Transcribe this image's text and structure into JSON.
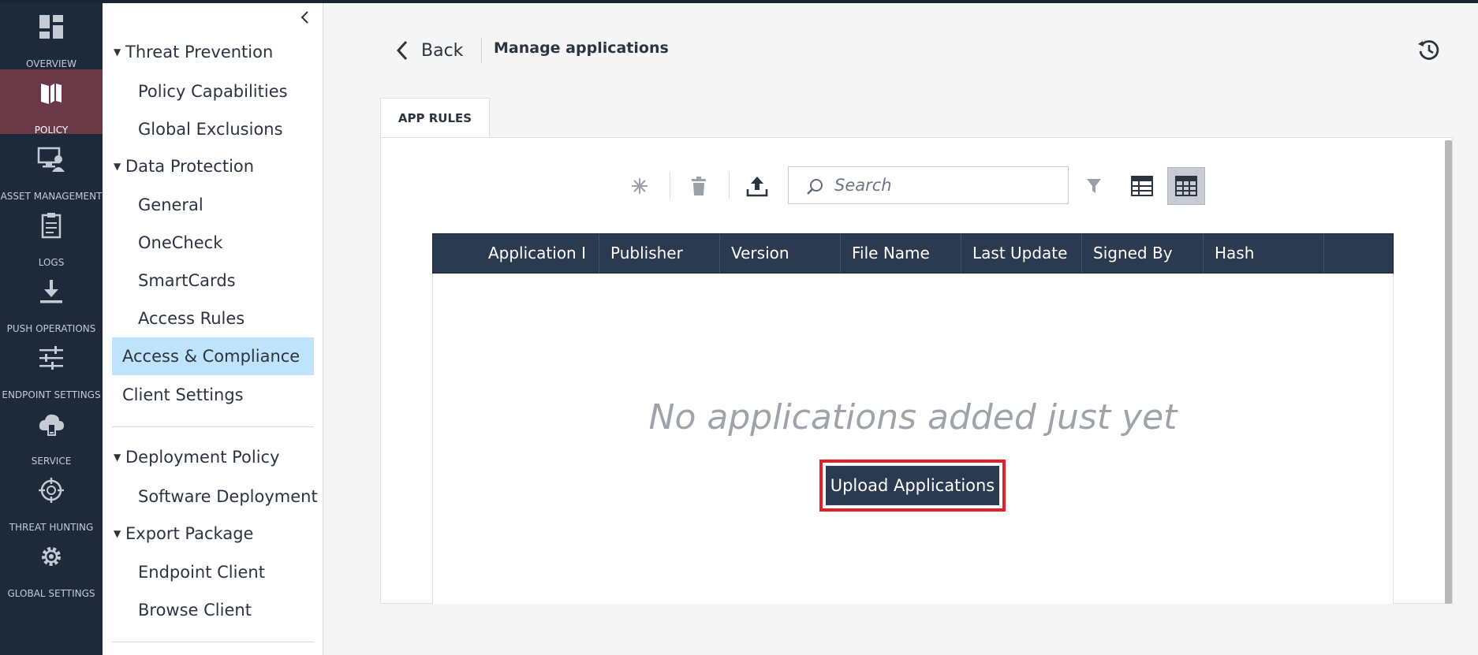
{
  "rail": {
    "items": [
      {
        "label": "OVERVIEW",
        "icon": "dashboard-icon"
      },
      {
        "label": "POLICY",
        "icon": "policy-icon",
        "active": true
      },
      {
        "label": "ASSET MANAGEMENT",
        "icon": "asset-management-icon"
      },
      {
        "label": "LOGS",
        "icon": "logs-icon"
      },
      {
        "label": "PUSH OPERATIONS",
        "icon": "push-operations-icon"
      },
      {
        "label": "ENDPOINT SETTINGS",
        "icon": "endpoint-settings-icon"
      },
      {
        "label": "SERVICE MANAGEMENT",
        "icon": "service-management-icon"
      },
      {
        "label": "THREAT HUNTING",
        "icon": "threat-hunting-icon"
      },
      {
        "label": "GLOBAL SETTINGS",
        "icon": "global-settings-icon"
      }
    ],
    "active_color": "#6b3848",
    "background": "#1e2a3a"
  },
  "tree": {
    "items": [
      {
        "label": "Threat Prevention"
      },
      {
        "label": "Policy Capabilities"
      },
      {
        "label": "Global Exclusions"
      },
      {
        "label": "Data Protection"
      },
      {
        "label": "General"
      },
      {
        "label": "OneCheck"
      },
      {
        "label": "SmartCards"
      },
      {
        "label": "Access Rules"
      },
      {
        "label": "Access & Compliance",
        "selected": true
      },
      {
        "label": "Client Settings"
      },
      {
        "label": "Deployment Policy"
      },
      {
        "label": "Software Deployment"
      },
      {
        "label": "Export Package"
      },
      {
        "label": "Endpoint Client"
      },
      {
        "label": "Browse Client"
      }
    ],
    "selected_color": "#bfe3fb"
  },
  "header": {
    "back_label": "Back",
    "title": "Manage applications"
  },
  "tabs": [
    {
      "label": "APP RULES",
      "active": true
    }
  ],
  "toolbar": {
    "search_placeholder": "Search",
    "buttons": [
      "new-icon",
      "delete-icon",
      "upload-icon",
      "filter-icon",
      "compact-view-icon",
      "table-view-icon"
    ]
  },
  "table": {
    "columns": [
      "Application I",
      "Publisher",
      "Version",
      "File Name",
      "Last Update",
      "Signed By",
      "Hash"
    ],
    "header_color": "#2a3a51"
  },
  "empty_state": {
    "message": "No applications added just yet",
    "button_label": "Upload Applications",
    "highlight_color": "#e0202a"
  }
}
